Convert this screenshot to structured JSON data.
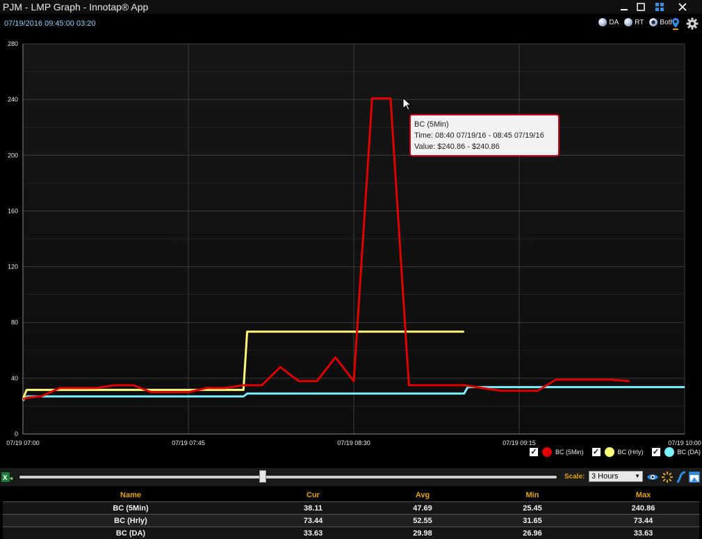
{
  "window": {
    "title": "PJM - LMP Graph - Innotap® App"
  },
  "topbar": {
    "timestamp": "07/19/2016 09:45:00  03:20",
    "radios": [
      {
        "label": "DA",
        "selected": false
      },
      {
        "label": "RT",
        "selected": false
      },
      {
        "label": "Both",
        "selected": true
      }
    ]
  },
  "colors": {
    "bc_5min": "#e00000",
    "bc_hrly": "#ffff7a",
    "bc_da": "#7af2ff",
    "accent": "#e4a400",
    "timestamp": "#8fd4ff"
  },
  "chart_data": {
    "type": "line",
    "xlabels": [
      "07/19 07:00",
      "07/19 07:45",
      "07/19 08:30",
      "07/19 09:15",
      "07/19 10:00"
    ],
    "xlim_minutes": [
      0,
      180
    ],
    "ylim": [
      0,
      280
    ],
    "yticks": [
      0,
      40,
      80,
      120,
      160,
      200,
      240,
      280
    ],
    "grid": true,
    "legend_position": "bottom-right",
    "series": [
      {
        "name": "BC (5Min)",
        "color": "#e00000",
        "x": [
          0,
          1,
          5,
          10,
          15,
          20,
          25,
          30,
          35,
          40,
          45,
          50,
          55,
          60,
          65,
          70,
          75,
          80,
          85,
          90,
          95,
          100,
          105,
          110,
          115,
          120,
          125,
          130,
          135,
          140,
          145,
          150,
          155,
          160,
          165
        ],
        "y": [
          25,
          26,
          27,
          33,
          33,
          33,
          35,
          35,
          30,
          30,
          30,
          33,
          33,
          35,
          35,
          48,
          38,
          38,
          55,
          38,
          240.86,
          240.86,
          35,
          35,
          35,
          35,
          33,
          31,
          31,
          31,
          39,
          39,
          39,
          39,
          38
        ]
      },
      {
        "name": "BC (Hrly)",
        "color": "#ffff7a",
        "x": [
          0,
          1,
          60,
          61,
          120
        ],
        "y": [
          25,
          31.65,
          31.65,
          73.44,
          73.44
        ]
      },
      {
        "name": "BC (DA)",
        "color": "#7af2ff",
        "x": [
          0,
          1,
          60,
          61,
          120,
          121,
          180
        ],
        "y": [
          24,
          26.96,
          26.96,
          29,
          29,
          33.63,
          33.63
        ]
      }
    ]
  },
  "tooltip": {
    "title": "BC (5Min)",
    "time": "Time: 08:40 07/19/16 - 08:45 07/19/16",
    "value": "Value: $240.86 - $240.86"
  },
  "controls": {
    "scale_label": "Scale:",
    "scale_value": "3 Hours",
    "slider_value_fraction": 0.45
  },
  "table": {
    "headers": [
      "Name",
      "Cur",
      "Avg",
      "Min",
      "Max"
    ],
    "rows": [
      [
        "BC (5Min)",
        "38.11",
        "47.69",
        "25.45",
        "240.86"
      ],
      [
        "BC (Hrly)",
        "73.44",
        "52.55",
        "31.65",
        "73.44"
      ],
      [
        "BC (DA)",
        "33.63",
        "29.98",
        "26.96",
        "33.63"
      ]
    ]
  }
}
